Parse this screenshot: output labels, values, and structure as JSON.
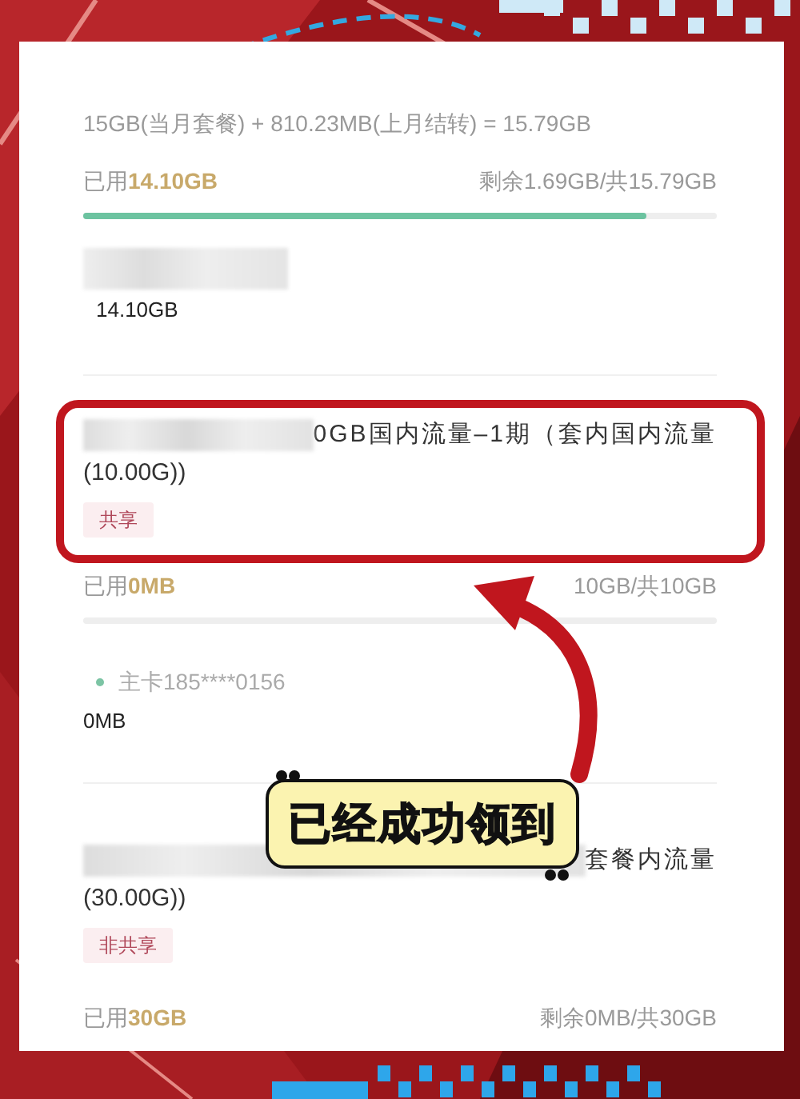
{
  "summary": {
    "formula": "15GB(当月套餐) + 810.23MB(上月结转) = 15.79GB",
    "used_label": "已用",
    "used": "14.10GB",
    "remaining": "剩余1.69GB/共15.79GB",
    "level": 0.89,
    "members": [
      {
        "kind": "redacted",
        "amount": "14.10GB"
      }
    ]
  },
  "plans": [
    {
      "title_lines": [
        "0GB国内流量–1期（套内国内流量",
        "(10.00G))"
      ],
      "tag": "共享",
      "highlighted": true,
      "used_label": "已用",
      "used": "0MB",
      "remaining": "10GB/共10GB",
      "level": 0,
      "members": [
        {
          "kind": "named",
          "name": "主卡185****0156",
          "color": "#7cc4a4",
          "amount": "0MB"
        }
      ]
    },
    {
      "title_lines": [
        "套餐内流量",
        "(30.00G))"
      ],
      "tag": "非共享",
      "highlighted": false,
      "used_label": "已用",
      "used": "30GB",
      "remaining": "剩余0MB/共30GB"
    }
  ],
  "callout": {
    "text": "已经成功领到"
  }
}
